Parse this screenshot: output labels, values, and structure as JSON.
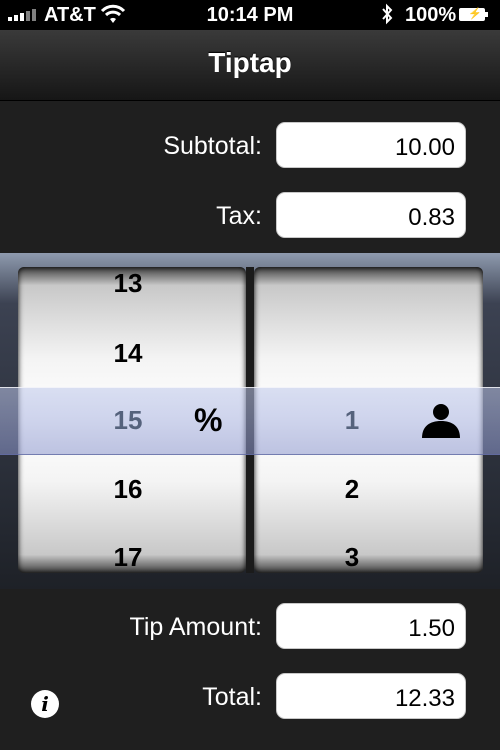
{
  "status_bar": {
    "carrier": "AT&T",
    "time": "10:14 PM",
    "battery": "100%"
  },
  "navbar": {
    "title": "Tiptap"
  },
  "form": {
    "subtotal_label": "Subtotal:",
    "subtotal_value": "10.00",
    "tax_label": "Tax:",
    "tax_value": "0.83",
    "tip_amount_label": "Tip Amount:",
    "tip_amount_value": "1.50",
    "total_label": "Total:",
    "total_value": "12.33"
  },
  "picker": {
    "percent_above": [
      "13",
      "14"
    ],
    "percent_selected": "15",
    "percent_below": [
      "16",
      "17"
    ],
    "percent_symbol": "%",
    "people_selected": "1",
    "people_below": [
      "2",
      "3"
    ],
    "people_icon": "person-icon"
  },
  "info_button": {
    "icon": "info-icon",
    "glyph": "i"
  },
  "colors": {
    "selection_band": "#aeb8e2",
    "background": "#1f1f1f"
  }
}
